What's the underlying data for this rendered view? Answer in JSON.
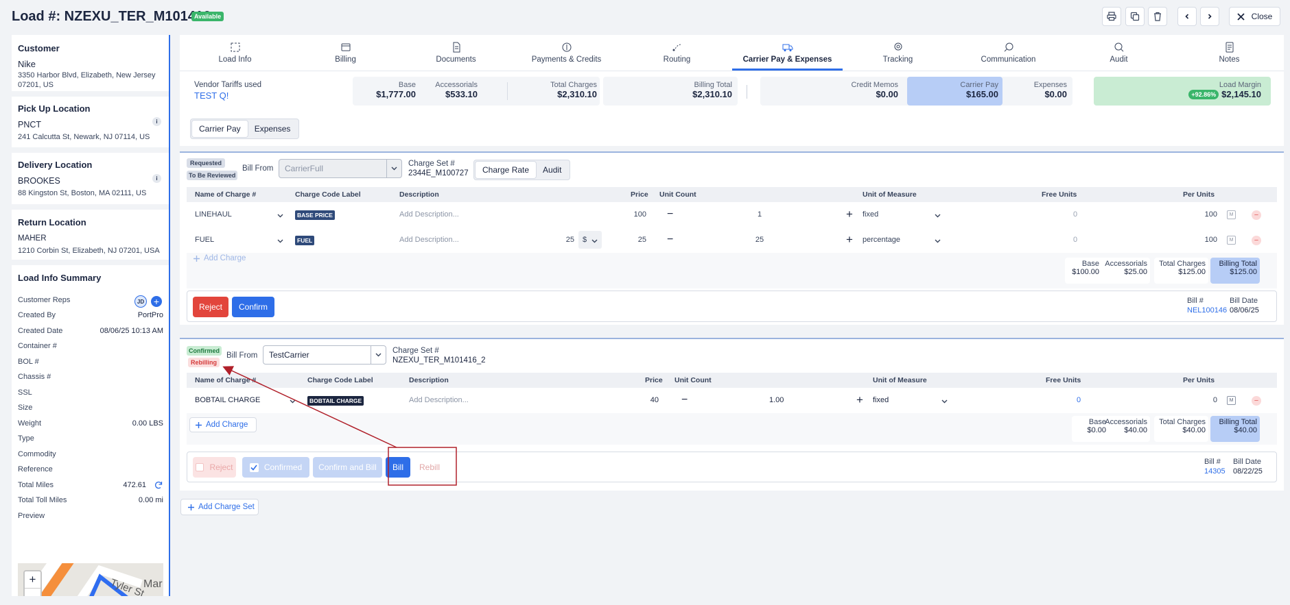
{
  "header": {
    "title": "Load #: NZEXU_TER_M101416",
    "status_badge": "Available",
    "close_label": "Close"
  },
  "sidebar": {
    "customer": {
      "heading": "Customer",
      "name": "Nike",
      "address": "3350 Harbor Blvd, Elizabeth, New Jersey 07201, US"
    },
    "pickup": {
      "heading": "Pick Up Location",
      "name": "PNCT",
      "address": "241 Calcutta St, Newark, NJ 07114, US"
    },
    "delivery": {
      "heading": "Delivery Location",
      "name": "BROOKES",
      "address": "88 Kingston St, Boston, MA 02111, US"
    },
    "return": {
      "heading": "Return Location",
      "name": "MAHER",
      "address": "1210 Corbin St, Elizabeth, NJ 07201, USA"
    },
    "summary": {
      "heading": "Load Info Summary",
      "reps_label": "Customer Reps",
      "rep_initials": "JD",
      "fields": [
        {
          "label": "Created By",
          "value": "PortPro"
        },
        {
          "label": "Created Date",
          "value": "08/06/25 10:13 AM"
        },
        {
          "label": "Container #",
          "value": ""
        },
        {
          "label": "BOL #",
          "value": ""
        },
        {
          "label": "Chassis #",
          "value": ""
        },
        {
          "label": "SSL",
          "value": ""
        },
        {
          "label": "Size",
          "value": ""
        },
        {
          "label": "Weight",
          "value": "0.00 LBS"
        },
        {
          "label": "Type",
          "value": ""
        },
        {
          "label": "Commodity",
          "value": ""
        },
        {
          "label": "Reference",
          "value": ""
        },
        {
          "label": "Total Miles",
          "value": "472.61"
        },
        {
          "label": "Total Toll Miles",
          "value": "0.00 mi"
        },
        {
          "label": "Preview",
          "value": ""
        }
      ],
      "map_labels": {
        "street1": "Tyler St",
        "street2": "Mar",
        "street3": "St",
        "zoom_in": "+",
        "zoom_out": "−"
      }
    }
  },
  "tabs": [
    {
      "label": "Load Info",
      "icon": "load-info-icon"
    },
    {
      "label": "Billing",
      "icon": "billing-icon"
    },
    {
      "label": "Documents",
      "icon": "document-icon"
    },
    {
      "label": "Payments & Credits",
      "icon": "payment-icon"
    },
    {
      "label": "Routing",
      "icon": "routing-icon"
    },
    {
      "label": "Carrier Pay & Expenses",
      "icon": "truck-icon",
      "active": true
    },
    {
      "label": "Tracking",
      "icon": "location-icon"
    },
    {
      "label": "Communication",
      "icon": "chat-icon"
    },
    {
      "label": "Audit",
      "icon": "audit-icon"
    },
    {
      "label": "Notes",
      "icon": "notes-icon"
    }
  ],
  "summary_bar": {
    "vendor_label": "Vendor Tariffs used",
    "vendor_value": "TEST Q!",
    "base": {
      "label": "Base",
      "value": "$1,777.00"
    },
    "accessorials": {
      "label": "Accessorials",
      "value": "$533.10"
    },
    "total_charges": {
      "label": "Total Charges",
      "value": "$2,310.10"
    },
    "billing_total": {
      "label": "Billing Total",
      "value": "$2,310.10"
    },
    "credit_memos": {
      "label": "Credit Memos",
      "value": "$0.00"
    },
    "carrier_pay": {
      "label": "Carrier Pay",
      "value": "$165.00"
    },
    "expenses": {
      "label": "Expenses",
      "value": "$0.00"
    },
    "load_margin": {
      "label": "Load Margin",
      "value": "$2,145.10",
      "pct": "+92.86%"
    }
  },
  "subtabs": {
    "carrier_pay": "Carrier Pay",
    "expenses": "Expenses"
  },
  "charge_set_1": {
    "status1": "Requested",
    "status2": "To Be Reviewed",
    "bill_from_label": "Bill From",
    "bill_from_value": "CarrierFull",
    "charge_set_label": "Charge Set #",
    "charge_set_value": "2344E_M100727",
    "toggle": {
      "left": "Charge Rate",
      "right": "Audit"
    },
    "columns": [
      "Name of Charge #",
      "Charge Code Label",
      "Description",
      "Price",
      "Unit Count",
      "Unit of Measure",
      "Free Units",
      "Per Units"
    ],
    "rows": [
      {
        "name": "LINEHAUL",
        "code": "BASE PRICE",
        "desc": "Add Description...",
        "price": "100",
        "unit_count": "1",
        "uom": "fixed",
        "free": "0",
        "per": "100",
        "extra_amount": "",
        "extra_currency": ""
      },
      {
        "name": "FUEL",
        "code": "FUEL",
        "desc": "Add Description...",
        "price": "25",
        "unit_count": "25",
        "uom": "percentage",
        "free": "0",
        "per": "100",
        "extra_amount": "25",
        "extra_currency": "$"
      }
    ],
    "add_charge": "Add Charge",
    "totals": {
      "base_label": "Base",
      "base": "$100.00",
      "acc_label": "Accessorials",
      "acc": "$25.00",
      "total_label": "Total Charges",
      "total": "$125.00",
      "billing_label": "Billing Total",
      "billing": "$125.00"
    },
    "reject": "Reject",
    "confirm": "Confirm",
    "bill_no_label": "Bill #",
    "bill_no": "NEL100146",
    "bill_date_label": "Bill Date",
    "bill_date": "08/06/25"
  },
  "charge_set_2": {
    "status1": "Confirmed",
    "status2": "Rebilling",
    "bill_from_label": "Bill From",
    "bill_from_value": "TestCarrier",
    "charge_set_label": "Charge Set #",
    "charge_set_value": "NZEXU_TER_M101416_2",
    "rows": [
      {
        "name": "BOBTAIL CHARGE",
        "code": "BOBTAIL CHARGE",
        "desc": "Add Description...",
        "price": "40",
        "unit_count": "1.00",
        "uom": "fixed",
        "free": "0",
        "per": "0"
      }
    ],
    "add_charge": "Add Charge",
    "totals": {
      "base_label": "Base",
      "base": "$0.00",
      "acc_label": "Accessorials",
      "acc": "$40.00",
      "total_label": "Total Charges",
      "total": "$40.00",
      "billing_label": "Billing Total",
      "billing": "$40.00"
    },
    "reject": "Reject",
    "confirmed": "Confirmed",
    "confirm_and_bill": "Confirm and Bill",
    "bill": "Bill",
    "rebill": "Rebill",
    "bill_no_label": "Bill #",
    "bill_no": "14305",
    "bill_date_label": "Bill Date",
    "bill_date": "08/22/25"
  },
  "add_charge_set": "Add Charge Set",
  "colors": {
    "accent": "#2e6ee8",
    "danger": "#e2453c",
    "annotation": "#b0202a",
    "success": "#3ab56a"
  }
}
